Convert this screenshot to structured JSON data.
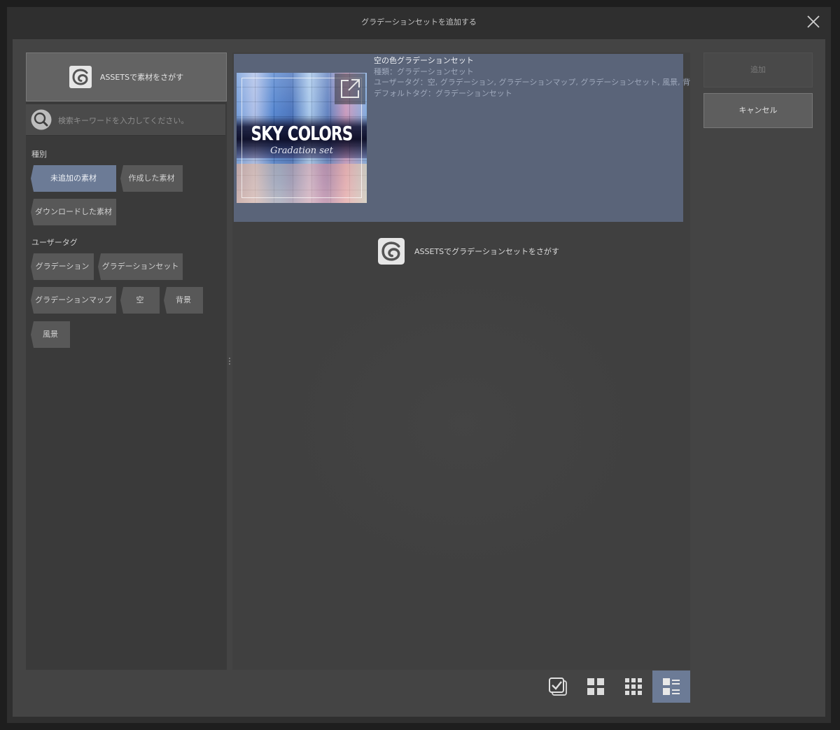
{
  "window": {
    "title": "グラデーションセットを追加する"
  },
  "left_pane": {
    "assets_button_label": "ASSETSで素材をさがす",
    "search_placeholder": "検索キーワードを入力してください。",
    "category_section": {
      "label": "種別",
      "items": [
        {
          "label": "未追加の素材",
          "selected": true
        },
        {
          "label": "作成した素材",
          "selected": false
        },
        {
          "label": "ダウンロードした素材",
          "selected": false
        }
      ]
    },
    "user_tag_section": {
      "label": "ユーザータグ",
      "items": [
        {
          "label": "グラデーション"
        },
        {
          "label": "グラデーションセット"
        },
        {
          "label": "グラデーションマップ"
        },
        {
          "label": "空"
        },
        {
          "label": "背景"
        },
        {
          "label": "風景"
        }
      ]
    }
  },
  "result": {
    "title": "空の色グラデーションセット",
    "meta_type": "種類：グラデーションセット",
    "meta_user_tags": "ユーザータグ：空, グラデーション, グラデーションマップ, グラデーションセット, 風景, 背景",
    "meta_default_tags": "デフォルトタグ：グラデーションセット",
    "thumbnail_title": "SKY COLORS",
    "thumbnail_subtitle": "Gradation set",
    "selected": true
  },
  "assets_search_link_label": "ASSETSでグラデーションセットをさがす",
  "buttons": {
    "add": "追加",
    "cancel": "キャンセル"
  },
  "view_modes": [
    {
      "icon": "check-list-icon",
      "active": false
    },
    {
      "icon": "large-grid-icon",
      "active": false
    },
    {
      "icon": "small-grid-icon",
      "active": false
    },
    {
      "icon": "detail-list-icon",
      "active": true
    }
  ],
  "colors": {
    "accent": "#6c7b96",
    "selected_card": "#5a6479",
    "panel": "#3a3a3a",
    "background": "#444444"
  }
}
